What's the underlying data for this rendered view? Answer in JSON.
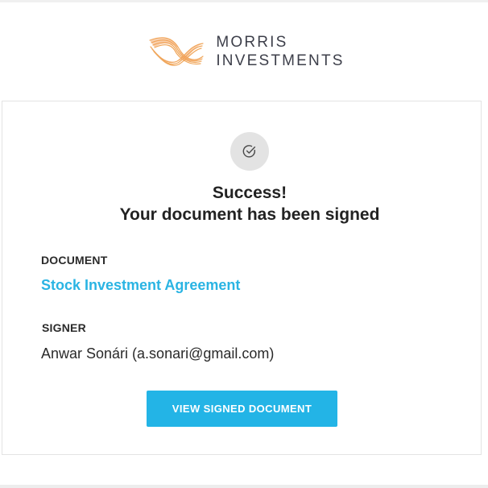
{
  "brand": {
    "line1": "MORRIS",
    "line2": "INVESTMENTS",
    "logo_icon": "wave-ribbon-logo",
    "logo_color": "#f0a65a",
    "text_color": "#3d3f4a"
  },
  "card": {
    "status_icon": "check-circle-icon",
    "title_line1": "Success!",
    "title_line2": "Your document has been signed",
    "document_label": "DOCUMENT",
    "document_name": "Stock Investment Agreement",
    "signer_label": "SIGNER",
    "signer_value": "Anwar Sonári (a.sonari@gmail.com)",
    "button_label": "VIEW SIGNED DOCUMENT"
  },
  "colors": {
    "accent": "#23b4e6",
    "link": "#2ab4e3",
    "icon_bg": "#e3e3e3",
    "card_border": "#e3e3e3"
  }
}
